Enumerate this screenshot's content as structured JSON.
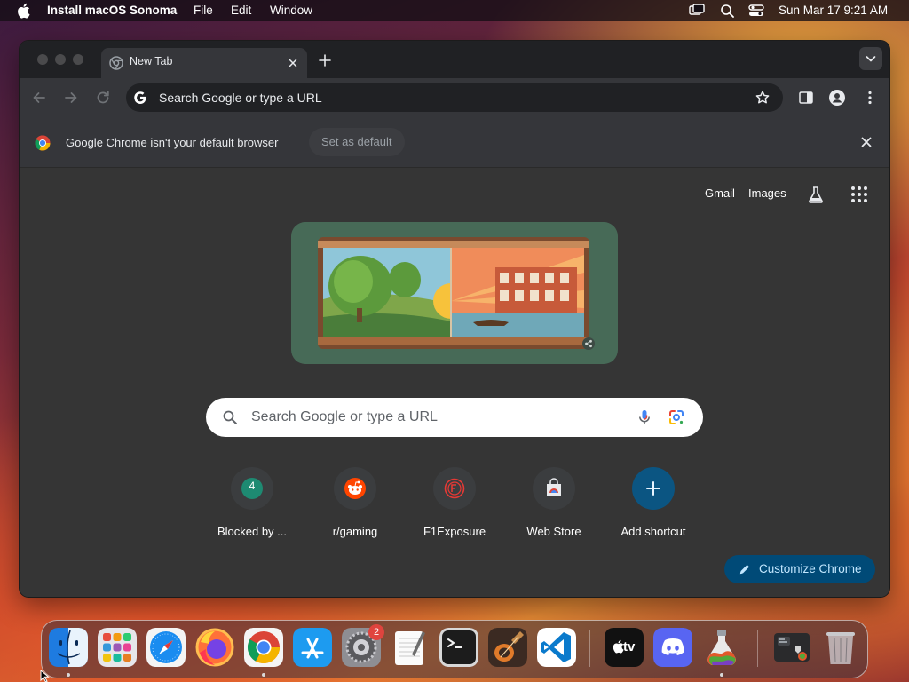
{
  "menubar": {
    "app_name": "Install macOS Sonoma",
    "menus": [
      "File",
      "Edit",
      "Window"
    ],
    "datetime": "Sun Mar 17  9:21 AM"
  },
  "browser": {
    "tab_title": "New Tab",
    "omnibox_placeholder": "Search Google or type a URL",
    "infobar": {
      "message": "Google Chrome isn't your default browser",
      "set_default_label": "Set as default"
    }
  },
  "ntp": {
    "links": {
      "gmail": "Gmail",
      "images": "Images"
    },
    "search_placeholder": "Search Google or type a URL",
    "shortcuts": [
      {
        "label": "Blocked by ...",
        "icon": "4"
      },
      {
        "label": "r/gaming",
        "icon": "reddit-icon"
      },
      {
        "label": "F1Exposure",
        "icon": "f1exposure-icon"
      },
      {
        "label": "Web Store",
        "icon": "web-store-icon"
      },
      {
        "label": "Add shortcut",
        "icon": "plus-icon"
      }
    ],
    "customize_label": "Customize Chrome"
  },
  "dock": {
    "apps": [
      "Finder",
      "Launchpad",
      "Safari",
      "Firefox",
      "Google Chrome",
      "App Store",
      "System Settings",
      "TextEdit",
      "Terminal",
      "GarageBand",
      "Visual Studio Code",
      "Apple TV",
      "Discord",
      "Install macOS Sonoma",
      "Downloads",
      "Trash"
    ],
    "settings_badge": "2",
    "tv_label": "tv"
  },
  "colors": {
    "chrome_frame": "#202124",
    "toolbar": "#35363a",
    "ntp_bg": "#353535",
    "customize_bg": "#004a77",
    "customize_text": "#c2e7ff",
    "doodle_bg": "#476a57"
  }
}
